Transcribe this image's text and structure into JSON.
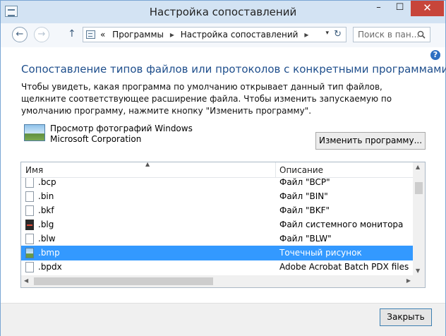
{
  "window": {
    "title": "Настройка сопоставлений",
    "controls": {
      "minimize": "–",
      "maximize": "☐",
      "close": "✕"
    }
  },
  "nav": {
    "back": "←",
    "forward": "→",
    "up": "↑",
    "address": {
      "prefix": "«",
      "crumbs": [
        "Программы",
        "Настройка сопоставлений"
      ],
      "separator": "▸",
      "dropdown": "▾",
      "refresh": "↻"
    },
    "search": {
      "placeholder": "Поиск в пан..."
    }
  },
  "content": {
    "help": "?",
    "heading": "Сопоставление типов файлов или протоколов с конкретными программами",
    "description": "Чтобы увидеть, какая программа по умолчанию открывает данный тип файлов, щелкните соответствующее расширение файла. Чтобы изменить запускаемую по умолчанию программу, нажмите кнопку \"Изменить программу\".",
    "program": {
      "name": "Просмотр фотографий Windows",
      "vendor": "Microsoft Corporation"
    },
    "change_button": "Изменить программу...",
    "list": {
      "columns": {
        "name": "Имя",
        "description": "Описание"
      },
      "sort_indicator": "▲",
      "rows": [
        {
          "name": ".bcp",
          "description": "Файл \"BCP\"",
          "icon": "file-icon",
          "selected": false
        },
        {
          "name": ".bin",
          "description": "Файл \"BIN\"",
          "icon": "file-icon",
          "selected": false
        },
        {
          "name": ".bkf",
          "description": "Файл \"BKF\"",
          "icon": "file-icon",
          "selected": false
        },
        {
          "name": ".blg",
          "description": "Файл системного монитора",
          "icon": "monitor-icon",
          "selected": false
        },
        {
          "name": ".blw",
          "description": "Файл \"BLW\"",
          "icon": "file-icon",
          "selected": false
        },
        {
          "name": ".bmp",
          "description": "Точечный рисунок",
          "icon": "image-icon",
          "selected": true
        },
        {
          "name": ".bpdx",
          "description": "Adobe Acrobat Batch PDX files",
          "icon": "file-icon",
          "selected": false
        }
      ],
      "scroll": {
        "up": "▲",
        "down": "▼",
        "left": "◀",
        "right": "▶"
      }
    }
  },
  "footer": {
    "close_button": "Закрыть"
  },
  "colors": {
    "accent": "#1e4e8c",
    "selection": "#3399ff",
    "close": "#c7453a"
  }
}
